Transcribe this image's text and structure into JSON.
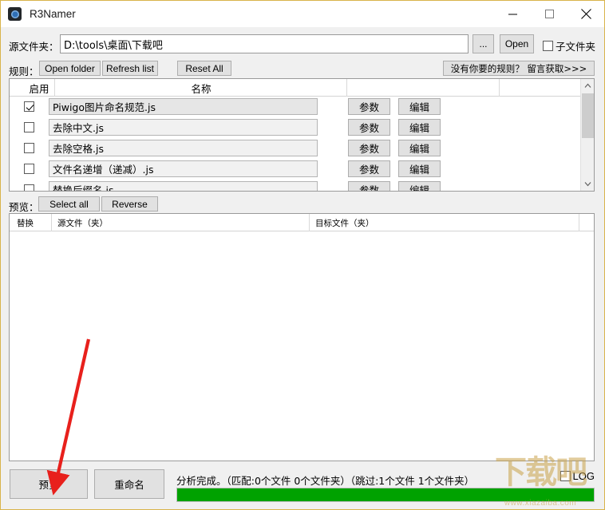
{
  "window": {
    "title": "R3Namer",
    "icon": "app-icon",
    "minimize": "–",
    "maximize": "□",
    "close": "✕"
  },
  "source": {
    "label": "源文件夹：",
    "path": "D:\\tools\\桌面\\下载吧",
    "browse_label": "...",
    "open_label": "Open",
    "subfolder_label": "子文件夹",
    "subfolder_checked": false
  },
  "rules_toolbar": {
    "label": "规则：",
    "open_folder": "Open folder",
    "refresh_list": "Refresh list",
    "reset_all": "Reset All",
    "get_rule": "没有你要的规则？ 留言获取>>>"
  },
  "rules_table": {
    "columns": [
      "启用",
      "名称",
      "",
      ""
    ],
    "param_label": "参数",
    "edit_label": "编辑",
    "rows": [
      {
        "enabled": true,
        "name": "Piwigo图片命名规范.js"
      },
      {
        "enabled": false,
        "name": "去除中文.js"
      },
      {
        "enabled": false,
        "name": "去除空格.js"
      },
      {
        "enabled": false,
        "name": "文件名递增（递减）.js"
      },
      {
        "enabled": false,
        "name": "替换后缀名.js"
      }
    ],
    "scroll_up": "⌃",
    "scroll_down": "⌄"
  },
  "preview": {
    "label": "预览：",
    "select_all": "Select all",
    "reverse": "Reverse",
    "columns": [
      "替换",
      "源文件（夹）",
      "目标文件（夹）"
    ],
    "rows": []
  },
  "bottom": {
    "preview_button": "预览",
    "rename_button": "重命名",
    "status": "分析完成。（匹配:0个文件 0个文件夹）（跳过:1个文件 1个文件夹）",
    "progress_percent": 100,
    "log_label": "LOG",
    "log_checked": false
  },
  "watermark": {
    "text": "下载吧",
    "url": "www.xiazaiba.com"
  },
  "colors": {
    "progress_green": "#00a200",
    "window_border": "#d9b44a",
    "annotation_red": "#e8201c"
  }
}
